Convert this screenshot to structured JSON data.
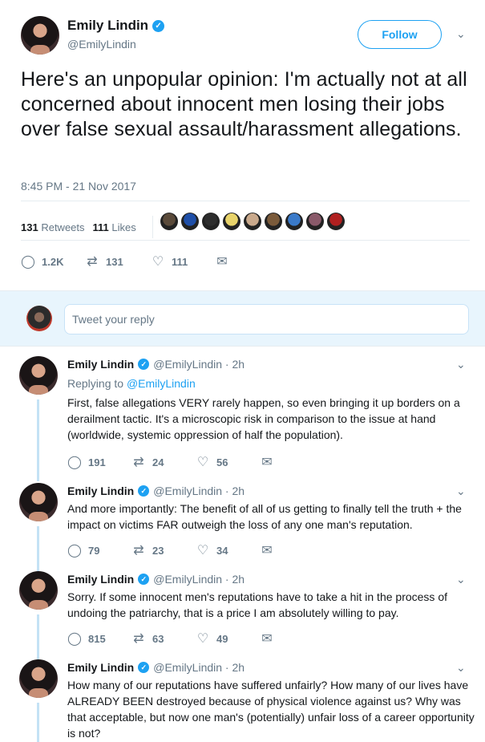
{
  "main_tweet": {
    "name": "Emily Lindin",
    "handle": "@EmilyLindin",
    "follow_label": "Follow",
    "text": "Here's an unpopular opinion: I'm actually not at all concerned about innocent men losing their jobs over false sexual assault/harassment allegations.",
    "timestamp": "8:45 PM - 21 Nov 2017",
    "retweets_count": "131",
    "retweets_label": "Retweets",
    "likes_count": "111",
    "likes_label": "Likes",
    "liker_colors": [
      "#5a4a3a",
      "#1f4fa8",
      "#2d2d2d",
      "#e8d36a",
      "#c9a98c",
      "#7a5a3a",
      "#3a7ac9",
      "#8a5a6a",
      "#b02020"
    ],
    "reply_count": "1.2K",
    "retweet_count": "131",
    "like_count": "111"
  },
  "reply_box": {
    "placeholder": "Tweet your reply"
  },
  "replies": [
    {
      "name": "Emily Lindin",
      "handle": "@EmilyLindin · 2h",
      "replying_prefix": "Replying to ",
      "replying_to": "@EmilyLindin",
      "text": "First, false allegations VERY rarely happen, so even bringing it up borders on a derailment tactic. It's a microscopic risk in comparison to the issue at hand (worldwide, systemic oppression of half the population).",
      "replies": "191",
      "retweets": "24",
      "likes": "56"
    },
    {
      "name": "Emily Lindin",
      "handle": "@EmilyLindin · 2h",
      "text": "And more importantly: The benefit of all of us getting to finally tell the truth + the impact on victims FAR outweigh the loss of any one man's reputation.",
      "replies": "79",
      "retweets": "23",
      "likes": "34"
    },
    {
      "name": "Emily Lindin",
      "handle": "@EmilyLindin · 2h",
      "text": "Sorry. If some innocent men's reputations have to take a hit in the process of undoing the patriarchy, that is a price I am absolutely willing to pay.",
      "replies": "815",
      "retweets": "63",
      "likes": "49"
    },
    {
      "name": "Emily Lindin",
      "handle": "@EmilyLindin · 2h",
      "text": "How many of our reputations have suffered unfairly? How many of our lives have ALREADY BEEN destroyed because of physical violence against us? Why was that acceptable, but now one man's (potentially) unfair loss of a career opportunity is not?"
    }
  ],
  "icons": {
    "verified": "✓",
    "caret": "⌄",
    "reply": "◯",
    "retweet": "⇄",
    "like": "♡",
    "dm": "✉"
  },
  "colors": {
    "accent": "#1da1f2",
    "muted": "#657786",
    "thread_line": "#c4e2f5",
    "reply_bg": "#e8f5fd"
  }
}
